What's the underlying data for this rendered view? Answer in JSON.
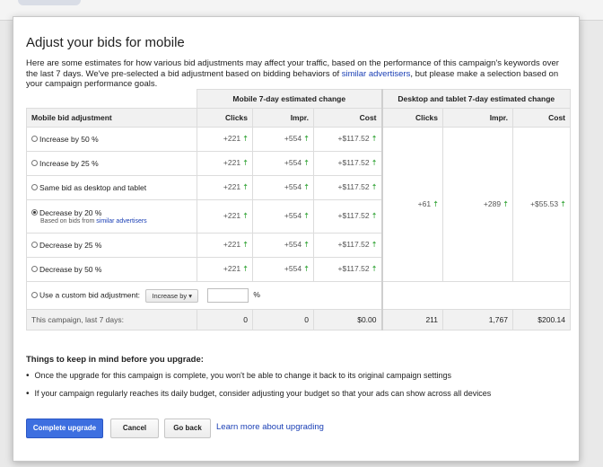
{
  "dialog": {
    "title": "Adjust your bids for mobile",
    "intro_before": "Here are some estimates for how various bid adjustments may affect your traffic, based on the performance of this campaign's keywords over the last 7 days. We've pre-selected a bid adjustment based on bidding behaviors of ",
    "intro_link": "similar advertisers",
    "intro_after": ", but please make a selection based on your campaign performance goals."
  },
  "table": {
    "group_mobile": "Mobile 7-day estimated change",
    "group_desktop": "Desktop and tablet 7-day estimated change",
    "col_adjustment": "Mobile bid adjustment",
    "col_clicks": "Clicks",
    "col_impr": "Impr.",
    "col_cost": "Cost",
    "rows": [
      {
        "label": "Increase by 50 %",
        "clicks": "+221",
        "impr": "+554",
        "cost": "+$117.52",
        "checked": false
      },
      {
        "label": "Increase by 25 %",
        "clicks": "+221",
        "impr": "+554",
        "cost": "+$117.52",
        "checked": false
      },
      {
        "label": "Same bid as desktop and tablet",
        "clicks": "+221",
        "impr": "+554",
        "cost": "+$117.52",
        "checked": false
      },
      {
        "label": "Decrease by 20 %",
        "note_before": "Based on bids from ",
        "note_link": "similar advertisers",
        "clicks": "+221",
        "impr": "+554",
        "cost": "+$117.52",
        "checked": true
      },
      {
        "label": "Decrease by 25 %",
        "clicks": "+221",
        "impr": "+554",
        "cost": "+$117.52",
        "checked": false
      },
      {
        "label": "Decrease by 50 %",
        "clicks": "+221",
        "impr": "+554",
        "cost": "+$117.52",
        "checked": false
      }
    ],
    "desktop_change": {
      "clicks": "+61",
      "impr": "+289",
      "cost": "+$55.53"
    },
    "custom": {
      "label": "Use a custom bid adjustment:",
      "dropdown": "Increase by",
      "value": "",
      "unit": "%"
    },
    "summary": {
      "label": "This campaign, last 7 days:",
      "mobile_clicks": "0",
      "mobile_impr": "0",
      "mobile_cost": "$0.00",
      "desktop_clicks": "211",
      "desktop_impr": "1,767",
      "desktop_cost": "$200.14"
    },
    "arrow_color": "#4caf50"
  },
  "notes": {
    "heading": "Things to keep in mind before you upgrade:",
    "items": [
      "Once the upgrade for this campaign is complete, you won't be able to change it back to its original campaign settings",
      "If your campaign regularly reaches its daily budget, consider adjusting your budget so that your ads can show across all devices"
    ]
  },
  "buttons": {
    "complete": "Complete upgrade",
    "cancel": "Cancel",
    "goback": "Go back",
    "learn_more": "Learn more about upgrading"
  },
  "colors": {
    "primary": "#3d6fe0",
    "link": "#1a3fb5"
  }
}
